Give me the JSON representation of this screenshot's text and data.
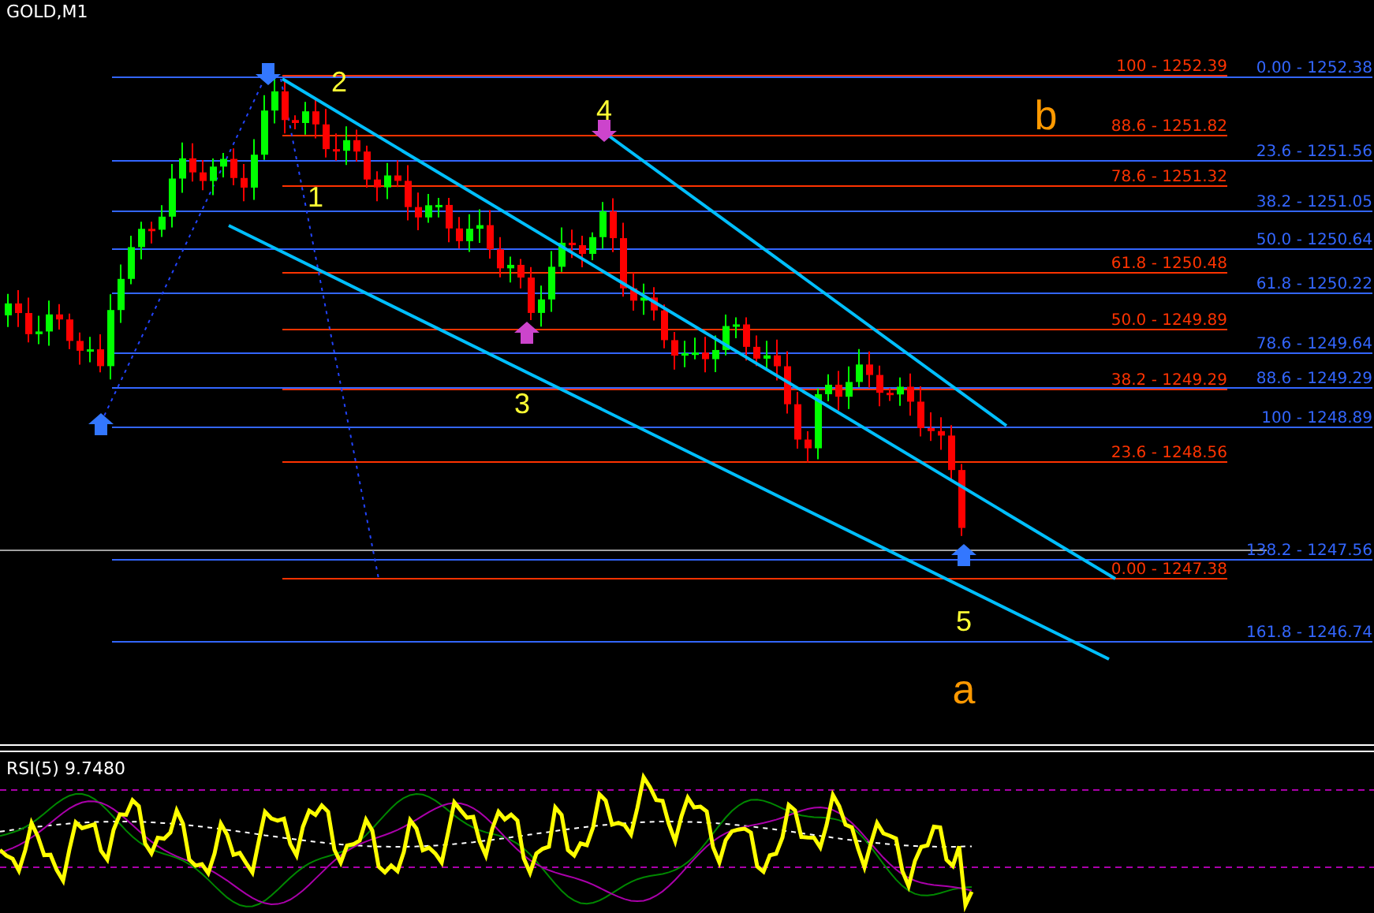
{
  "chart": {
    "symbol": "GOLD,M1",
    "wave_labels": [
      {
        "text": "2",
        "color": "#ffff33"
      },
      {
        "text": "1",
        "color": "#ffff33"
      },
      {
        "text": "4",
        "color": "#ffff33"
      },
      {
        "text": "3",
        "color": "#ffff33"
      },
      {
        "text": "b",
        "color": "#ff9900"
      },
      {
        "text": "5",
        "color": "#ffff33"
      },
      {
        "text": "a",
        "color": "#ff9900"
      }
    ],
    "fib_sets": [
      {
        "color": "#ff3300",
        "levels": [
          {
            "label": "100 - 1252.39"
          },
          {
            "label": "88.6 - 1251.82"
          },
          {
            "label": "78.6 - 1251.32"
          },
          {
            "label": "61.8 - 1250.48"
          },
          {
            "label": "50.0 - 1249.89"
          },
          {
            "label": "38.2 - 1249.29"
          },
          {
            "label": "23.6 - 1248.56"
          },
          {
            "label": "0.00 -  1247.38"
          }
        ]
      },
      {
        "color": "#3366ff",
        "levels": [
          {
            "label": "0.00 -  1252.38"
          },
          {
            "label": "23.6 - 1251.56"
          },
          {
            "label": "38.2 - 1251.05"
          },
          {
            "label": "50.0 - 1250.64"
          },
          {
            "label": "61.8 - 1250.22"
          },
          {
            "label": "78.6 - 1249.64"
          },
          {
            "label": "88.6 - 1249.29"
          },
          {
            "label": "100 - 1248.89"
          },
          {
            "label": "138.2 - 1247.56"
          },
          {
            "label": "161.8 - 1246.74"
          }
        ]
      }
    ]
  },
  "indicator": {
    "title": "RSI(5) 9.7480"
  }
}
